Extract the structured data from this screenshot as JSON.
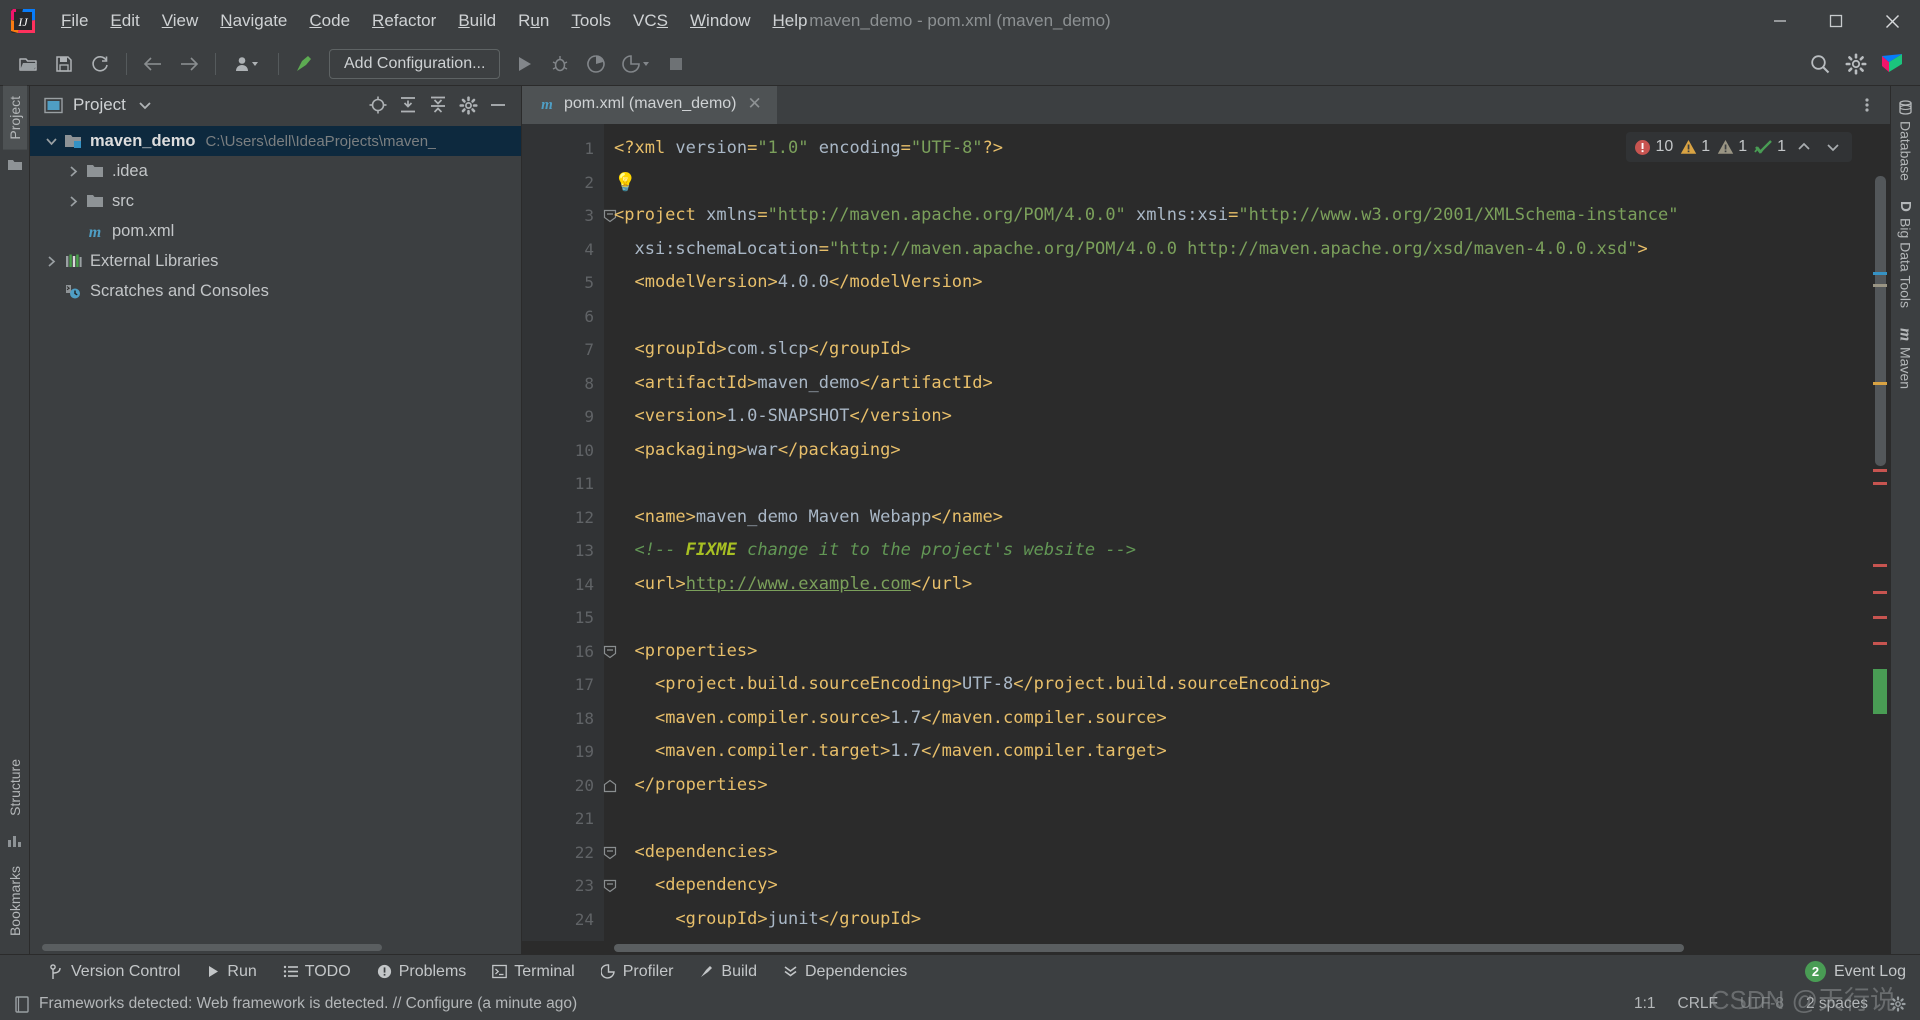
{
  "window": {
    "title": "maven_demo - pom.xml (maven_demo)",
    "minimize_label": "Minimize",
    "maximize_label": "Maximize",
    "close_label": "Close"
  },
  "menubar": {
    "items": [
      {
        "label": "File",
        "mnemonic": "F"
      },
      {
        "label": "Edit",
        "mnemonic": "E"
      },
      {
        "label": "View",
        "mnemonic": "V"
      },
      {
        "label": "Navigate",
        "mnemonic": "N"
      },
      {
        "label": "Code",
        "mnemonic": "C"
      },
      {
        "label": "Refactor",
        "mnemonic": "R"
      },
      {
        "label": "Build",
        "mnemonic": "B"
      },
      {
        "label": "Run",
        "mnemonic": "u"
      },
      {
        "label": "Tools",
        "mnemonic": "T"
      },
      {
        "label": "VCS",
        "mnemonic": "S"
      },
      {
        "label": "Window",
        "mnemonic": "W"
      },
      {
        "label": "Help",
        "mnemonic": "H"
      }
    ]
  },
  "toolbar": {
    "open_label": "Open",
    "save_label": "Save All",
    "sync_label": "Synchronize",
    "back_label": "Back",
    "forward_label": "Forward",
    "profile_label": "Select Run/Debug Profile",
    "build_label": "Build Project",
    "add_configuration": "Add Configuration...",
    "run_label": "Run",
    "debug_label": "Debug",
    "run_coverage_label": "Run with Coverage",
    "profile_run_label": "Profile",
    "stop_label": "Stop",
    "search_label": "Search Everywhere",
    "settings_label": "Settings",
    "account_label": "Account"
  },
  "left_rail": {
    "project_tab": "Project",
    "structure_tab": "Structure",
    "bookmarks_tab": "Bookmarks"
  },
  "project_panel": {
    "title": "Project",
    "collapse_all_label": "Collapse All",
    "expand_all_label": "Expand All",
    "locate_label": "Select Opened File",
    "settings_label": "Options",
    "hide_label": "Hide",
    "tree": [
      {
        "label": "maven_demo",
        "path": "C:\\Users\\dell\\IdeaProjects\\maven_",
        "icon": "module-folder-icon",
        "indent": 0,
        "twisty": "expanded",
        "selected": true,
        "bold": true
      },
      {
        "label": ".idea",
        "path": "",
        "icon": "folder-icon",
        "indent": 1,
        "twisty": "collapsed",
        "selected": false,
        "bold": false
      },
      {
        "label": "src",
        "path": "",
        "icon": "folder-icon",
        "indent": 1,
        "twisty": "collapsed",
        "selected": false,
        "bold": false
      },
      {
        "label": "pom.xml",
        "path": "",
        "icon": "maven-file-icon",
        "indent": 1,
        "twisty": "none",
        "selected": false,
        "bold": false
      },
      {
        "label": "External Libraries",
        "path": "",
        "icon": "libraries-icon",
        "indent": 0,
        "twisty": "collapsed",
        "selected": false,
        "bold": false
      },
      {
        "label": "Scratches and Consoles",
        "path": "",
        "icon": "scratches-icon",
        "indent": 0,
        "twisty": "none",
        "selected": false,
        "bold": false
      }
    ]
  },
  "editor": {
    "tab": {
      "label": "pom.xml (maven_demo)",
      "icon": "maven-file-icon",
      "close_label": "Close Tab"
    },
    "more_label": "More",
    "inspections": {
      "errors": "10",
      "warnings": "1",
      "weak_warnings": "1",
      "checks": "1",
      "prev_label": "Previous Highlighted Error",
      "next_label": "Next Highlighted Error"
    },
    "lines": [
      {
        "n": "1",
        "fold": "none",
        "bulb": false
      },
      {
        "n": "2",
        "fold": "none",
        "bulb": true
      },
      {
        "n": "3",
        "fold": "start",
        "bulb": false
      },
      {
        "n": "4",
        "fold": "none",
        "bulb": false
      },
      {
        "n": "5",
        "fold": "none",
        "bulb": false
      },
      {
        "n": "6",
        "fold": "none",
        "bulb": false
      },
      {
        "n": "7",
        "fold": "none",
        "bulb": false
      },
      {
        "n": "8",
        "fold": "none",
        "bulb": false
      },
      {
        "n": "9",
        "fold": "none",
        "bulb": false
      },
      {
        "n": "10",
        "fold": "none",
        "bulb": false
      },
      {
        "n": "11",
        "fold": "none",
        "bulb": false
      },
      {
        "n": "12",
        "fold": "none",
        "bulb": false
      },
      {
        "n": "13",
        "fold": "none",
        "bulb": false
      },
      {
        "n": "14",
        "fold": "none",
        "bulb": false
      },
      {
        "n": "15",
        "fold": "none",
        "bulb": false
      },
      {
        "n": "16",
        "fold": "start",
        "bulb": false
      },
      {
        "n": "17",
        "fold": "none",
        "bulb": false
      },
      {
        "n": "18",
        "fold": "none",
        "bulb": false
      },
      {
        "n": "19",
        "fold": "none",
        "bulb": false
      },
      {
        "n": "20",
        "fold": "end",
        "bulb": false
      },
      {
        "n": "21",
        "fold": "none",
        "bulb": false
      },
      {
        "n": "22",
        "fold": "start",
        "bulb": false
      },
      {
        "n": "23",
        "fold": "start",
        "bulb": false
      },
      {
        "n": "24",
        "fold": "none",
        "bulb": false
      }
    ],
    "code_text": [
      "<?xml version=\"1.0\" encoding=\"UTF-8\"?>",
      "",
      "<project xmlns=\"http://maven.apache.org/POM/4.0.0\" xmlns:xsi=\"http://www.w3.org/2001/XMLSchema-instance\"",
      "  xsi:schemaLocation=\"http://maven.apache.org/POM/4.0.0 http://maven.apache.org/xsd/maven-4.0.0.xsd\">",
      "  <modelVersion>4.0.0</modelVersion>",
      "",
      "  <groupId>com.slcp</groupId>",
      "  <artifactId>maven_demo</artifactId>",
      "  <version>1.0-SNAPSHOT</version>",
      "  <packaging>war</packaging>",
      "",
      "  <name>maven_demo Maven Webapp</name>",
      "  <!-- FIXME change it to the project's website -->",
      "  <url>http://www.example.com</url>",
      "",
      "  <properties>",
      "    <project.build.sourceEncoding>UTF-8</project.build.sourceEncoding>",
      "    <maven.compiler.source>1.7</maven.compiler.source>",
      "    <maven.compiler.target>1.7</maven.compiler.target>",
      "  </properties>",
      "",
      "  <dependencies>",
      "    <dependency>",
      "      <groupId>junit</groupId>"
    ]
  },
  "right_rail": {
    "tabs": [
      {
        "label": "Database",
        "icon": "database-icon"
      },
      {
        "label": "Big Data Tools",
        "icon": "bigdata-icon"
      },
      {
        "label": "Maven",
        "icon": "maven-icon"
      }
    ]
  },
  "toolwindow_bar": {
    "items": [
      {
        "label": "Version Control",
        "icon": "branch-icon"
      },
      {
        "label": "Run",
        "icon": "play-icon"
      },
      {
        "label": "TODO",
        "icon": "list-icon"
      },
      {
        "label": "Problems",
        "icon": "error-icon"
      },
      {
        "label": "Terminal",
        "icon": "terminal-icon"
      },
      {
        "label": "Profiler",
        "icon": "profiler-icon"
      },
      {
        "label": "Build",
        "icon": "hammer-icon"
      },
      {
        "label": "Dependencies",
        "icon": "dependencies-icon"
      }
    ],
    "event_log": {
      "label": "Event Log",
      "count": "2"
    }
  },
  "statusbar": {
    "message": "Frameworks detected: Web framework is detected. // Configure (a minute ago)",
    "caret": "1:1",
    "line_separator": "CRLF",
    "encoding": "UTF-8",
    "indent": "2 spaces",
    "watermark": "CSDN @天行说"
  },
  "colors": {
    "accent_blue": "#3592c4",
    "selection": "#0d293e",
    "error_red": "#c75450",
    "warning_yellow": "#d9a343",
    "ok_green": "#499c54",
    "editor_bg": "#2b2b2b",
    "chrome_bg": "#3c3f41"
  }
}
